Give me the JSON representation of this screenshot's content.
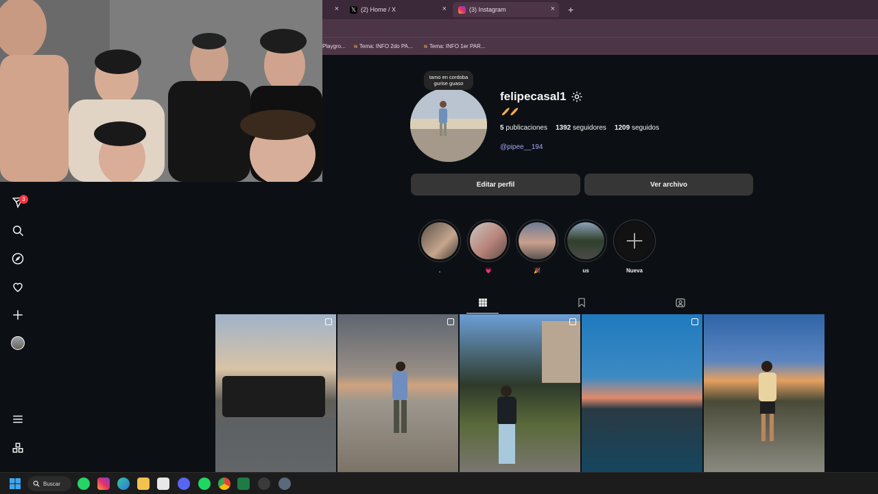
{
  "browser": {
    "tabs": [
      {
        "label": "",
        "favicon": ""
      },
      {
        "label": "(2) Home / X",
        "favicon": "x-logo-icon"
      },
      {
        "label": "(3) Instagram",
        "favicon": "instagram-icon",
        "active": true
      }
    ],
    "close_glyph": "×",
    "new_tab_glyph": "+",
    "bookmarks": [
      {
        "label": "Playgro..."
      },
      {
        "label": "Tema: INFO 2do PA..."
      },
      {
        "label": "Tema: INFO 1er PAR..."
      }
    ]
  },
  "sidebar": {
    "notification_count": "3",
    "items": [
      "messenger-icon",
      "search-icon",
      "explore-icon",
      "heart-icon",
      "create-icon",
      "profile-avatar",
      "menu-icon",
      "more-icon"
    ]
  },
  "profile": {
    "note": "tamo en cordoba gurise guaso",
    "username": "felipecasal1",
    "bio_emoji": "🥖🥖",
    "stats": {
      "posts_count": "5",
      "posts_label": "publicaciones",
      "followers_count": "1392",
      "followers_label": "seguidores",
      "following_count": "1209",
      "following_label": "seguidos"
    },
    "threads_handle": "@pipee__194",
    "edit_button": "Editar perfil",
    "archive_button": "Ver archivo"
  },
  "highlights": [
    {
      "label": "."
    },
    {
      "label": "💗"
    },
    {
      "label": "🎉"
    },
    {
      "label": "us"
    },
    {
      "label": "Nueva"
    }
  ],
  "taskbar": {
    "search_label": "Buscar"
  }
}
